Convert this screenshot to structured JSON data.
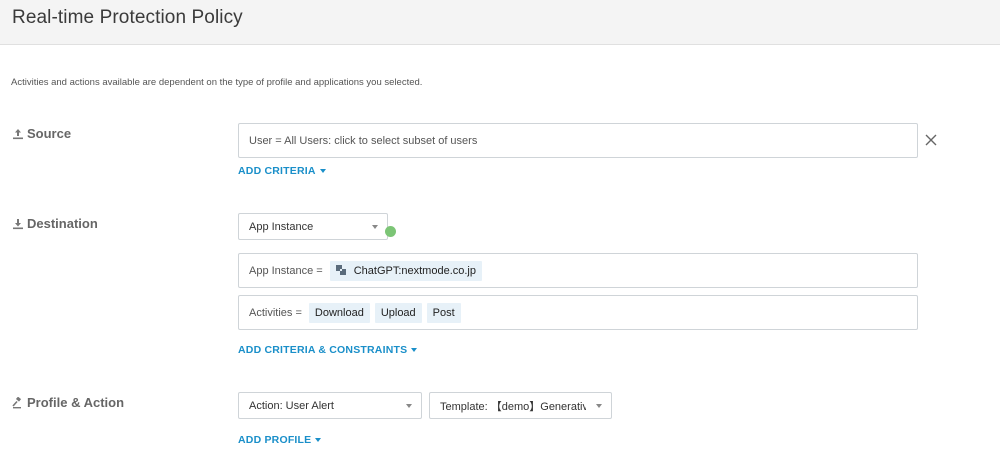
{
  "header": {
    "title": "Real-time Protection Policy"
  },
  "note": "Activities and actions available are dependent on the type of profile and applications you selected.",
  "source": {
    "label": "Source",
    "icon": "upload-icon",
    "user_field": "User = All Users: click to select subset of users",
    "add_criteria": "ADD CRITERIA"
  },
  "destination": {
    "label": "Destination",
    "icon": "download-icon",
    "type_select": "App Instance",
    "app_instance_label": "App Instance =",
    "app_instance_chip": "ChatGPT:nextmode.co.jp",
    "activities_label": "Activities =",
    "activities": [
      "Download",
      "Upload",
      "Post"
    ],
    "add_criteria": "ADD CRITERIA & CONSTRAINTS",
    "status_color": "#7cc576"
  },
  "profile_action": {
    "label": "Profile & Action",
    "icon": "gavel-icon",
    "action_select": "Action: User Alert",
    "template_select": "Template: 【demo】Generative",
    "add_profile": "ADD PROFILE"
  },
  "colors": {
    "accent": "#1a8fc9",
    "chip_bg": "#e7f1f8"
  }
}
